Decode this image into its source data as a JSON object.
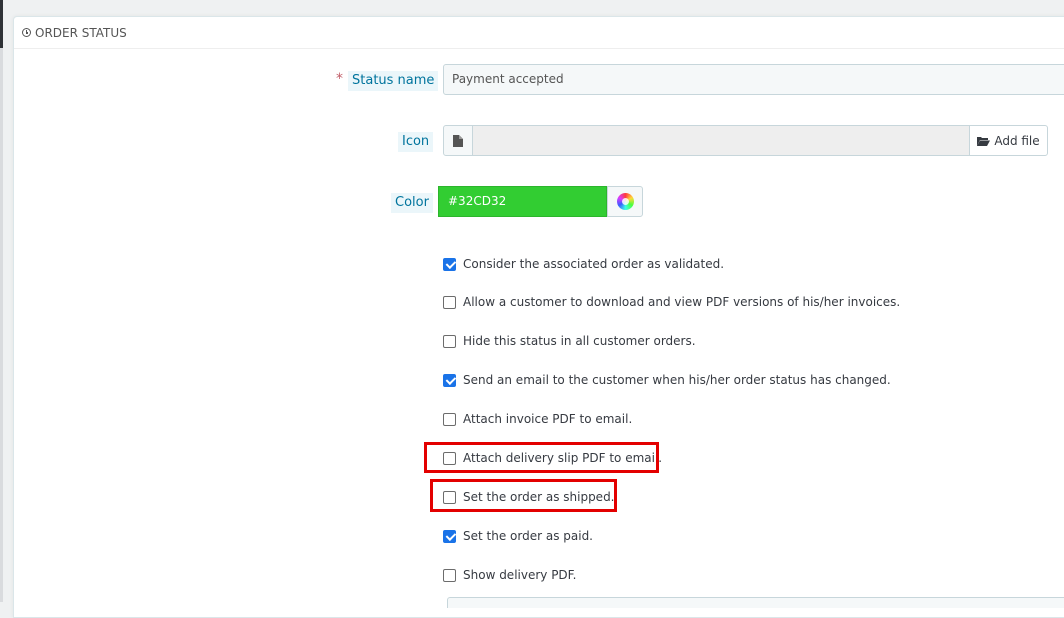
{
  "panel": {
    "title": "ORDER STATUS"
  },
  "form": {
    "status_name": {
      "required_mark": "*",
      "label": "Status name",
      "value": "Payment  accepted"
    },
    "icon": {
      "label": "Icon",
      "button_label": "Add file"
    },
    "color": {
      "label": "Color",
      "value": "#32CD32",
      "swatch": "#32CD32"
    },
    "options": [
      {
        "label": "Consider the associated order as validated.",
        "checked": true
      },
      {
        "label": "Allow a customer to download and view PDF versions of his/her invoices.",
        "checked": false
      },
      {
        "label": "Hide this status in all customer orders.",
        "checked": false
      },
      {
        "label": "Send an email to the customer when his/her order status has changed.",
        "checked": true
      },
      {
        "label": "Attach invoice PDF to email.",
        "checked": false
      },
      {
        "label": "Attach delivery slip PDF to email.",
        "checked": false
      },
      {
        "label": "Set the order as shipped.",
        "checked": false
      },
      {
        "label": "Set the order as paid.",
        "checked": true
      },
      {
        "label": "Show delivery PDF.",
        "checked": false
      }
    ]
  },
  "theme": {
    "label_color": "#00749d",
    "checkbox_checked": "#1a73e8",
    "highlight": "#e30000"
  }
}
